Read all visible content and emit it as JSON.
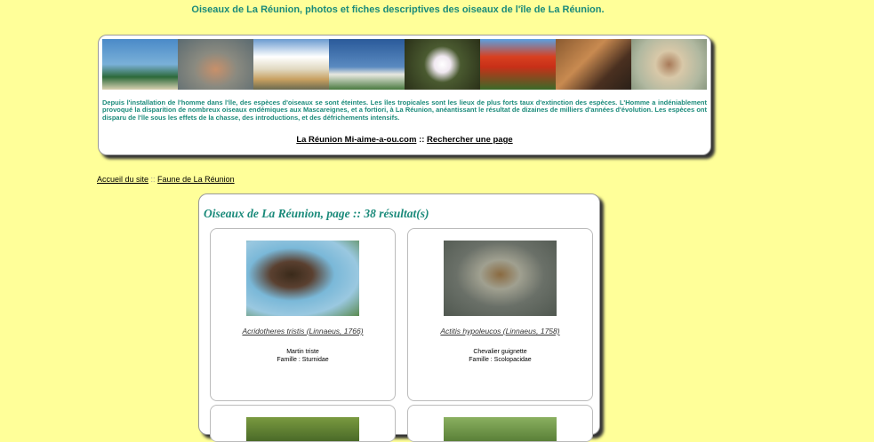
{
  "header": {
    "title": "Oiseaux de La Réunion, photos et fiches descriptives des oiseaux de l'île de La Réunion."
  },
  "banner": {
    "intro": "Depuis l'installation de l'homme dans l'île, des espèces d'oiseaux se sont éteintes. Les îles tropicales sont les lieux de plus forts taux d'extinction des espèces. L'Homme a indéniablement provoqué la disparition de nombreux oiseaux endémiques aux Mascareignes, et a fortiori, à La Réunion, anéantissant le résultat de dizaines de milliers d'années d'évolution. Les espèces ont disparu de l'île sous les effets de la chasse, des introductions, et des défrichements intensifs.",
    "link1": "La Réunion Mi-aime-a-ou.com",
    "sep": " :: ",
    "link2": "Rechercher une page"
  },
  "breadcrumb": {
    "home": "Accueil du site",
    "sep": " :: ",
    "section": "Faune de La Réunion"
  },
  "results": {
    "title": "Oiseaux de La Réunion, page :: 38 résultat(s)",
    "cards": [
      {
        "scientific": "Acridotheres tristis (Linnaeus, 1766)",
        "common": "Martin triste",
        "family": "Famille : Sturnidae"
      },
      {
        "scientific": "Actitis hypoleucos (Linnaeus, 1758)",
        "common": "Chevalier guignette",
        "family": "Famille : Scolopacidae"
      }
    ]
  }
}
